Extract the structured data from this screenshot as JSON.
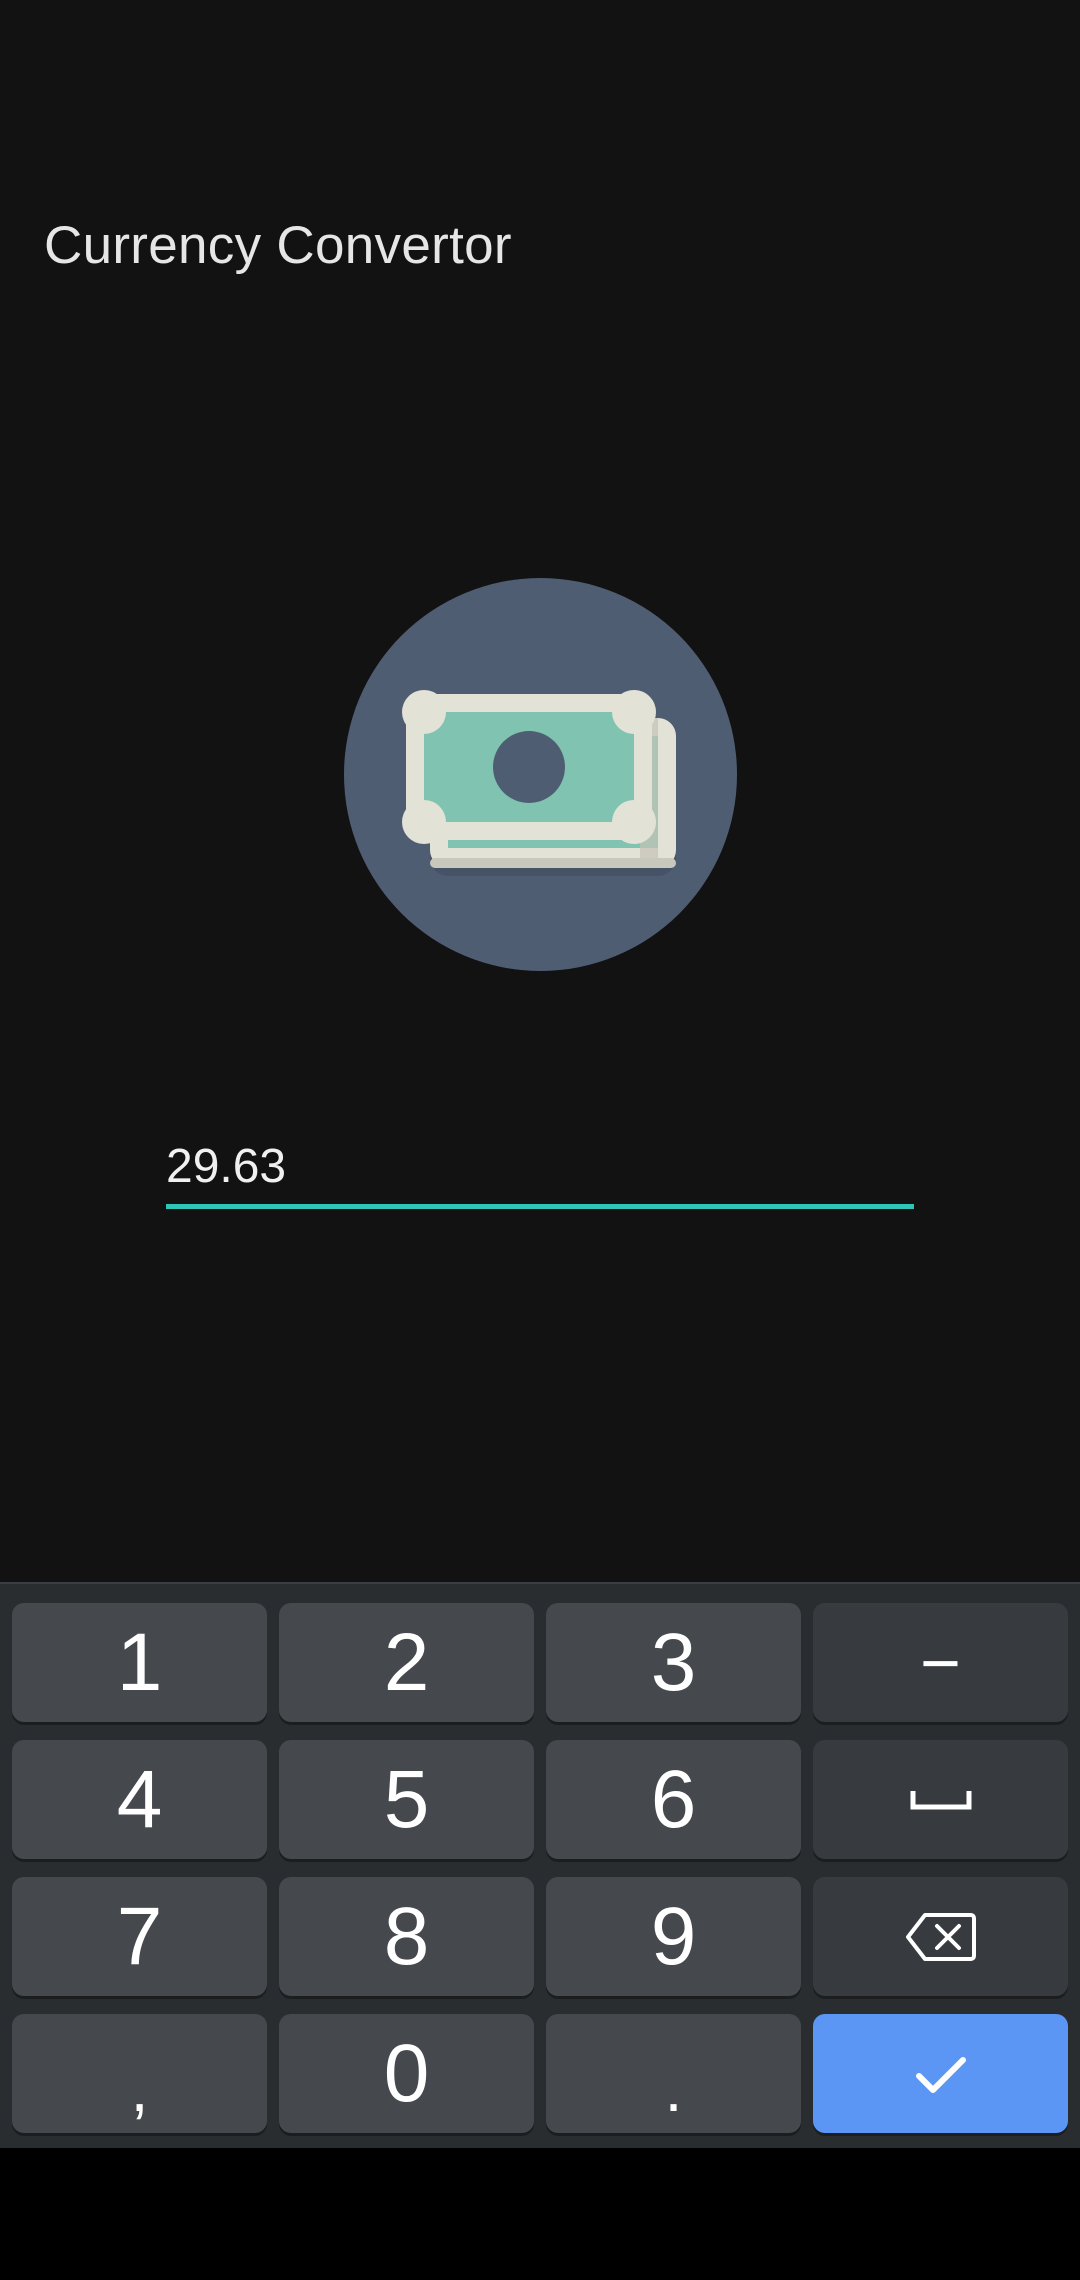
{
  "app": {
    "title": "Currency Convertor"
  },
  "illustration": {
    "icon": "money-banknote-icon",
    "circle_color": "#4f5d73",
    "bill_color": "#7fc3b0",
    "bill_border_color": "#e3e2d6"
  },
  "amount_field": {
    "value": "29.63",
    "underline_color": "#2ec4b6"
  },
  "keyboard": {
    "rows": [
      [
        {
          "label": "1",
          "type": "digit"
        },
        {
          "label": "2",
          "type": "digit"
        },
        {
          "label": "3",
          "type": "digit"
        },
        {
          "label": "−",
          "type": "func",
          "icon": "minus-icon"
        }
      ],
      [
        {
          "label": "4",
          "type": "digit"
        },
        {
          "label": "5",
          "type": "digit"
        },
        {
          "label": "6",
          "type": "digit"
        },
        {
          "label": "",
          "type": "func",
          "icon": "space-icon"
        }
      ],
      [
        {
          "label": "7",
          "type": "digit"
        },
        {
          "label": "8",
          "type": "digit"
        },
        {
          "label": "9",
          "type": "digit"
        },
        {
          "label": "",
          "type": "func",
          "icon": "backspace-icon"
        }
      ],
      [
        {
          "label": ",",
          "type": "digit"
        },
        {
          "label": "0",
          "type": "digit"
        },
        {
          "label": ".",
          "type": "digit"
        },
        {
          "label": "",
          "type": "action",
          "icon": "checkmark-icon"
        }
      ]
    ],
    "action_color": "#5b96f4"
  }
}
